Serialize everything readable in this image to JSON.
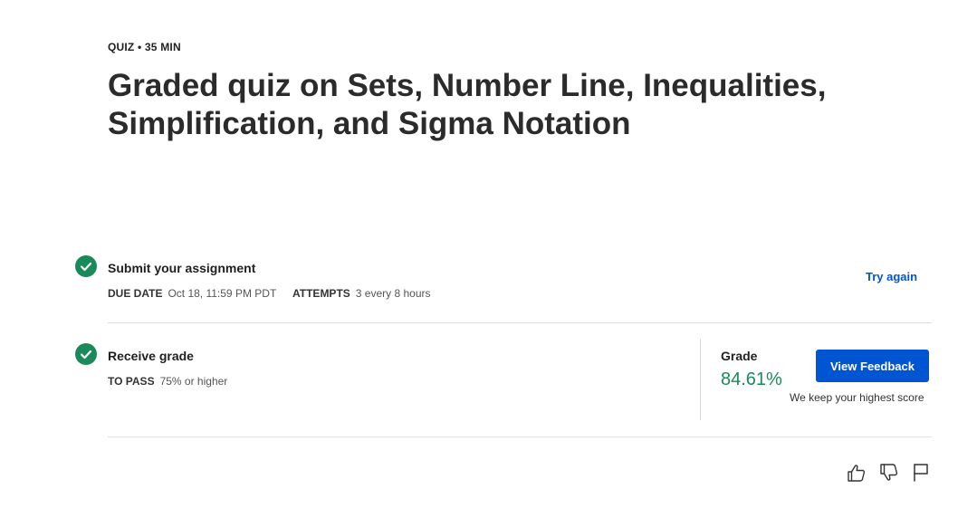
{
  "header": {
    "meta": "QUIZ • 35 MIN",
    "title": "Graded quiz on Sets, Number Line, Inequalities, Simplification, and Sigma Notation"
  },
  "submit": {
    "title": "Submit your assignment",
    "due_label": "DUE DATE",
    "due_value": "Oct 18, 11:59 PM PDT",
    "attempts_label": "ATTEMPTS",
    "attempts_value": "3 every 8 hours",
    "try_again": "Try again",
    "icon": "check-circle-icon"
  },
  "receive": {
    "title": "Receive grade",
    "pass_label": "TO PASS",
    "pass_value": "75% or higher",
    "icon": "check-circle-icon"
  },
  "grade": {
    "label": "Grade",
    "value": "84.61%",
    "button": "View Feedback",
    "note": "We keep your highest score"
  },
  "feedback_icons": [
    "thumbs-up-icon",
    "thumbs-down-icon",
    "flag-icon"
  ],
  "colors": {
    "accent": "#0056d2",
    "success": "#1a8a5a"
  }
}
